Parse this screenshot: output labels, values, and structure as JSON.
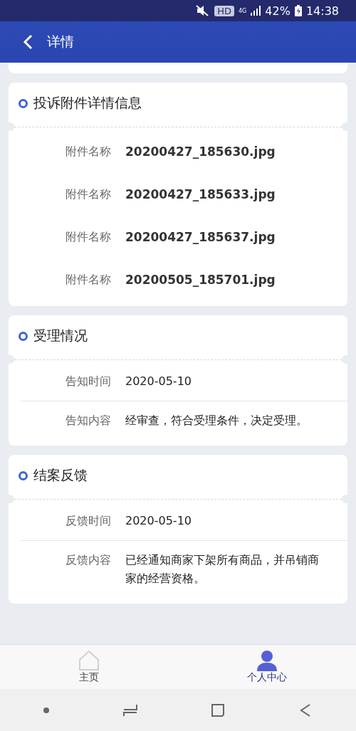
{
  "status_bar": {
    "hd": "HD",
    "network": "4G",
    "battery": "42%",
    "time": "14:38"
  },
  "app_bar": {
    "title": "详情"
  },
  "sections": [
    {
      "title": "投诉附件详情信息",
      "row_dividers": false,
      "rows": [
        {
          "label": "附件名称",
          "value": "20200427_185630.jpg",
          "kind": "file"
        },
        {
          "label": "附件名称",
          "value": "20200427_185633.jpg",
          "kind": "file"
        },
        {
          "label": "附件名称",
          "value": "20200427_185637.jpg",
          "kind": "file"
        },
        {
          "label": "附件名称",
          "value": "20200505_185701.jpg",
          "kind": "file"
        }
      ]
    },
    {
      "title": "受理情况",
      "row_dividers": true,
      "rows": [
        {
          "label": "告知时间",
          "value": "2020-05-10",
          "kind": "text"
        },
        {
          "label": "告知内容",
          "value": "经审查，符合受理条件，决定受理。",
          "kind": "text"
        }
      ]
    },
    {
      "title": "结案反馈",
      "row_dividers": true,
      "rows": [
        {
          "label": "反馈时间",
          "value": "2020-05-10",
          "kind": "text"
        },
        {
          "label": "反馈内容",
          "value": "已经通知商家下架所有商品，并吊销商家的经营资格。",
          "kind": "text"
        }
      ]
    }
  ],
  "tabs": [
    {
      "label": "主页",
      "kind": "home",
      "selected": false
    },
    {
      "label": "个人中心",
      "kind": "user",
      "selected": true
    }
  ]
}
